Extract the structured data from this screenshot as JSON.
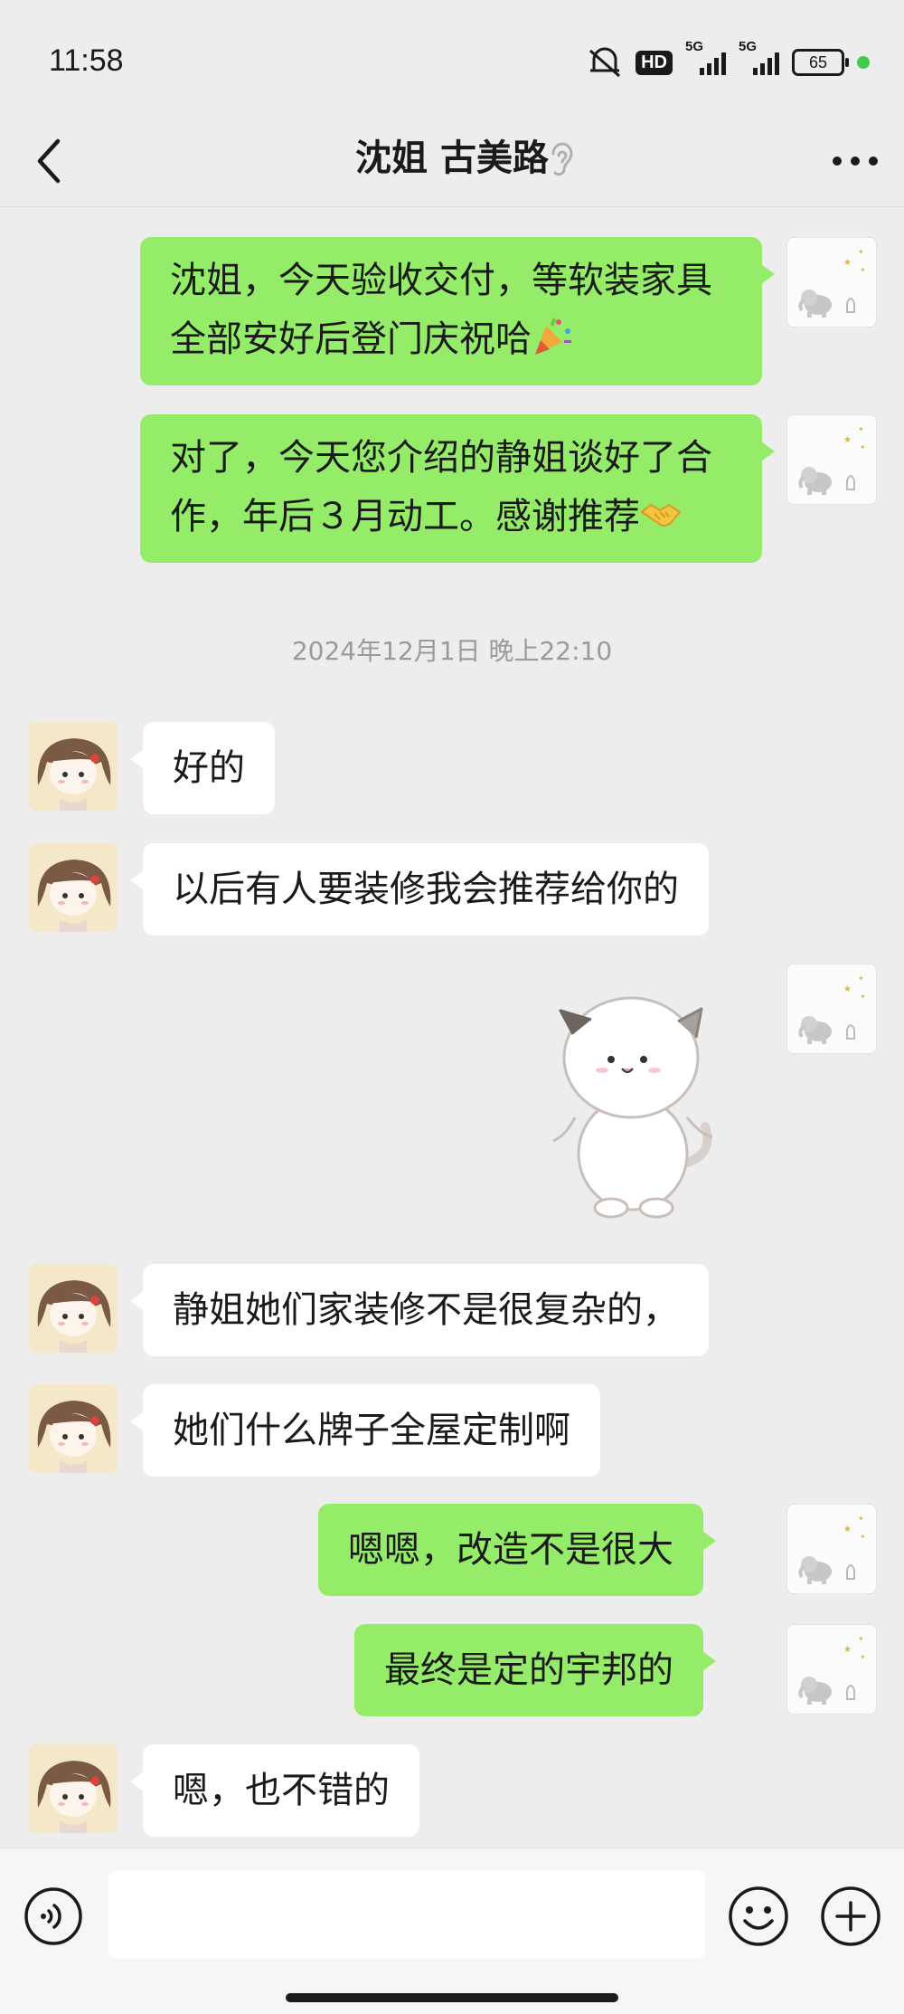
{
  "status_bar": {
    "time": "11:58",
    "hd_badge": "HD",
    "network_1": "5G",
    "network_2": "5G",
    "battery": "65"
  },
  "header": {
    "title": "沈姐 古美路"
  },
  "messages": {
    "m1": {
      "text": "沈姐，今天验收交付，等软装家具全部安好后登门庆祝哈",
      "emoji": "party-popper"
    },
    "m2": {
      "text": "对了，今天您介绍的静姐谈好了合作，年后３月动工。感谢推荐",
      "emoji": "handshake"
    },
    "timestamp": "2024年12月1日 晚上22:10",
    "m3": {
      "text": "好的"
    },
    "m4": {
      "text": "以后有人要装修我会推荐给你的"
    },
    "m5": {
      "sticker": "cat-sticker"
    },
    "m6": {
      "text": "静姐她们家装修不是很复杂的，"
    },
    "m7": {
      "text": "她们什么牌子全屋定制啊"
    },
    "m8": {
      "text": "嗯嗯，改造不是很大"
    },
    "m9": {
      "text": "最终是定的宇邦的"
    },
    "m10": {
      "text": "嗯，也不错的"
    }
  },
  "colors": {
    "sent_bubble": "#95ec69",
    "received_bubble": "#ffffff",
    "background": "#ededed",
    "status_dot": "#42c94f"
  },
  "icons": [
    "back-arrow-icon",
    "ear-icon",
    "more-icon",
    "voice-icon",
    "emoji-icon",
    "plus-icon",
    "mute-icon"
  ]
}
